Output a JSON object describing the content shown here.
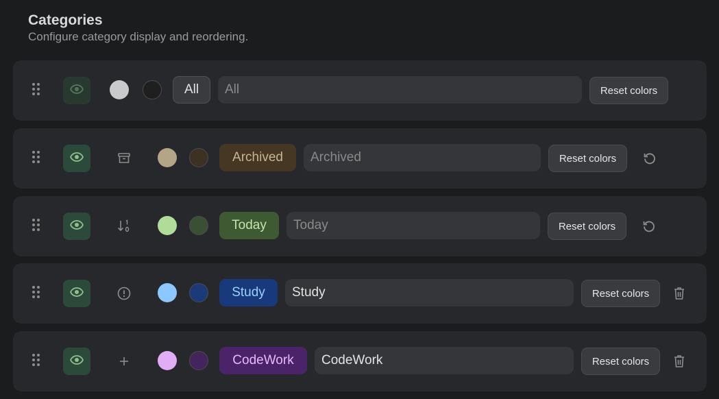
{
  "header": {
    "title": "Categories",
    "subtitle": "Configure category display and reordering."
  },
  "reset_label": "Reset colors",
  "colors": {
    "row_bg": "#27282b",
    "page_bg": "#1b1c1e",
    "visibility_green": "#8fbf8f"
  },
  "categories": [
    {
      "id": "all",
      "chip_label": "All",
      "input_value": "",
      "input_placeholder": "All",
      "visible": true,
      "visibility_dimmed": true,
      "type_icon": "none",
      "text_color": "#c9cacc",
      "bg_color": "#1f1f1f",
      "chip_text": "#e3e3e3",
      "chip_bg": "#3a3b3f",
      "end_icon": "none"
    },
    {
      "id": "archived",
      "chip_label": "Archived",
      "input_value": "",
      "input_placeholder": "Archived",
      "visible": true,
      "visibility_dimmed": false,
      "type_icon": "archive-icon",
      "text_color": "#b3a586",
      "bg_color": "#3d3122",
      "chip_text": "#c7b597",
      "chip_bg": "#463723",
      "end_icon": "restore-icon"
    },
    {
      "id": "today",
      "chip_label": "Today",
      "input_value": "",
      "input_placeholder": "Today",
      "visible": true,
      "visibility_dimmed": false,
      "type_icon": "sort-numeric-icon",
      "text_color": "#b0dc9a",
      "bg_color": "#3a5032",
      "chip_text": "#c1e4ac",
      "chip_bg": "#3e5a33",
      "end_icon": "restore-icon"
    },
    {
      "id": "study",
      "chip_label": "Study",
      "input_value": "Study",
      "input_placeholder": "",
      "visible": true,
      "visibility_dimmed": false,
      "type_icon": "alert-circle-icon",
      "text_color": "#8cc8ff",
      "bg_color": "#1a3a78",
      "chip_text": "#9fd0ff",
      "chip_bg": "#18397b",
      "end_icon": "trash-icon"
    },
    {
      "id": "codework",
      "chip_label": "CodeWork",
      "input_value": "CodeWork",
      "input_placeholder": "",
      "visible": true,
      "visibility_dimmed": false,
      "type_icon": "plus-icon",
      "text_color": "#e1aef5",
      "bg_color": "#43245c",
      "chip_text": "#eab8fb",
      "chip_bg": "#4b2368",
      "end_icon": "trash-icon"
    }
  ]
}
